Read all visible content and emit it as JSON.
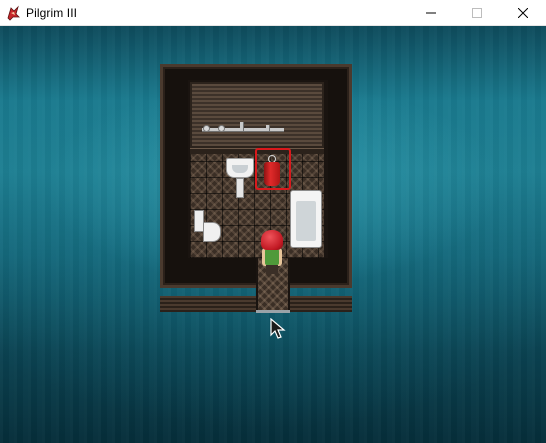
{
  "window": {
    "title": "Pilgrim III",
    "app_icon": "pilgrim-app-icon",
    "controls": [
      "minimize-icon",
      "maximize-icon",
      "close-icon"
    ]
  },
  "scene": {
    "background_colors": [
      "#0e4b5c",
      "#1e7f92",
      "#062e3a"
    ],
    "highlight_color": "#d9191c",
    "highlighted_object": "towel",
    "objects": [
      "sink",
      "towel",
      "bathtub",
      "toilet",
      "character"
    ]
  },
  "cursor": {
    "icon": "arrow-cursor-icon"
  }
}
